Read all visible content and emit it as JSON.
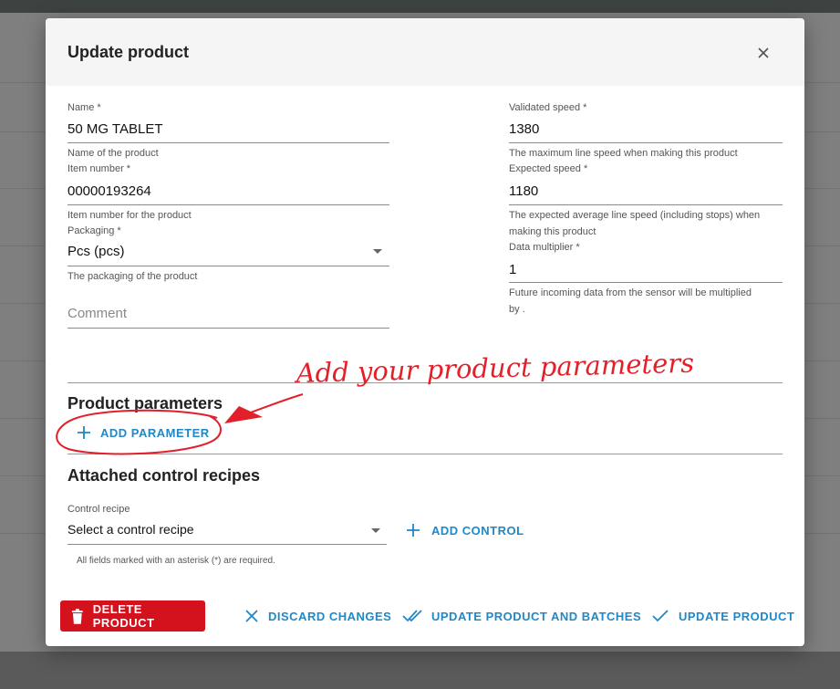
{
  "dialog": {
    "title": "Update product",
    "close_icon": "close-icon"
  },
  "form": {
    "name": {
      "label": "Name *",
      "value": "50 MG TABLET",
      "hint": "Name of the product"
    },
    "item_number": {
      "label": "Item number *",
      "value": "00000193264",
      "hint": "Item number for the product"
    },
    "packaging": {
      "label": "Packaging *",
      "value": "Pcs (pcs)",
      "hint": "The packaging of the product"
    },
    "comment": {
      "placeholder": "Comment"
    },
    "validated_speed": {
      "label": "Validated speed *",
      "value": "1380",
      "hint": "The maximum line speed when making this product"
    },
    "expected_speed": {
      "label": "Expected speed *",
      "value": "1180",
      "hint_line1": "The expected average line speed (including stops) when",
      "hint_line2": "making this product"
    },
    "data_multiplier": {
      "label": "Data multiplier *",
      "value": "1",
      "hint_line1": "Future incoming data from the sensor will be multiplied",
      "hint_line2": "by ."
    }
  },
  "annotation": {
    "text": "Add your product parameters",
    "color": "#e3202a"
  },
  "parameters": {
    "title": "Product parameters",
    "add_label": "ADD PARAMETER"
  },
  "controls": {
    "title": "Attached control recipes",
    "recipe_label": "Control recipe",
    "recipe_value": "Select a control recipe",
    "add_label": "ADD CONTROL"
  },
  "footer": {
    "required_note": "All fields marked with an asterisk (*) are required.",
    "delete_label": "DELETE PRODUCT",
    "discard_label": "DISCARD CHANGES",
    "update_batches_label": "UPDATE PRODUCT AND BATCHES",
    "update_label": "UPDATE PRODUCT"
  },
  "colors": {
    "accent": "#1e88c8",
    "danger": "#d3121e"
  }
}
